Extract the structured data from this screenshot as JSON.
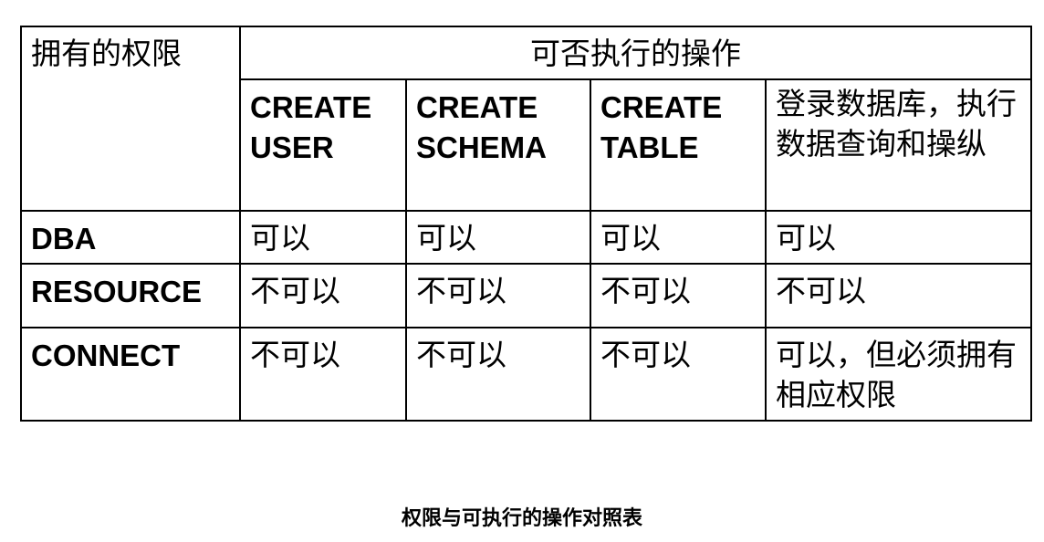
{
  "table": {
    "corner_header": "拥有的权限",
    "ops_header": "可否执行的操作",
    "op_columns": [
      "CREATE USER",
      "CREATE SCHEMA",
      "CREATE TABLE",
      "登录数据库，执行数据查询和操纵"
    ],
    "rows": [
      {
        "role": "DBA",
        "cells": [
          "可以",
          "可以",
          "可以",
          "可以"
        ]
      },
      {
        "role": "RESOURCE",
        "cells": [
          "不可以",
          "不可以",
          "不可以",
          "不可以"
        ]
      },
      {
        "role": "CONNECT",
        "cells": [
          "不可以",
          "不可以",
          "不可以",
          "可以，但必须拥有相应权限"
        ]
      }
    ]
  },
  "caption": "权限与可执行的操作对照表"
}
